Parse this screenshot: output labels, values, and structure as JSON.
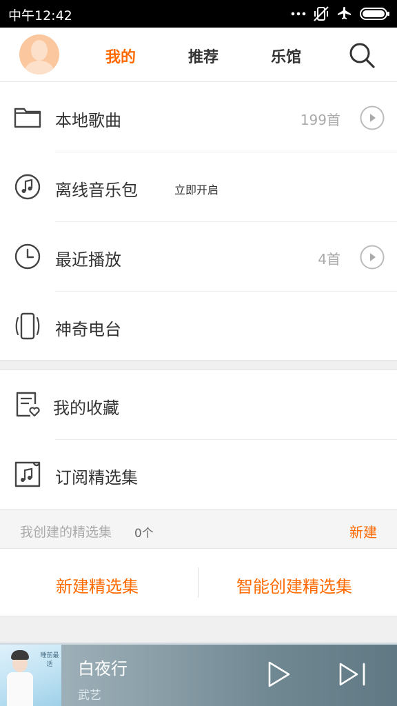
{
  "status": {
    "time": "中午12:42"
  },
  "header": {
    "tabs": [
      {
        "label": "我的",
        "active": true
      },
      {
        "label": "推荐",
        "active": false
      },
      {
        "label": "乐馆",
        "active": false
      }
    ]
  },
  "rows": [
    {
      "label": "本地歌曲",
      "count": "199首",
      "icon": "folder-icon"
    },
    {
      "label": "离线音乐包",
      "sub": "立即开启",
      "icon": "music-note-circle-icon"
    },
    {
      "label": "最近播放",
      "count": "4首",
      "icon": "clock-icon"
    },
    {
      "label": "神奇电台",
      "icon": "phone-radio-icon"
    }
  ],
  "rows2": [
    {
      "label": "我的收藏",
      "icon": "favorite-list-icon"
    },
    {
      "label": "订阅精选集",
      "icon": "music-ticket-icon"
    }
  ],
  "created": {
    "title": "我创建的精选集",
    "count": "0个",
    "new_label": "新建"
  },
  "actions": {
    "new_collection": "新建精选集",
    "smart_create": "智能创建精选集"
  },
  "player": {
    "title": "白夜行",
    "artist": "武艺",
    "cover_text": "睡前最适"
  },
  "colors": {
    "accent": "#ff6a00",
    "statusbar": "#000000"
  }
}
